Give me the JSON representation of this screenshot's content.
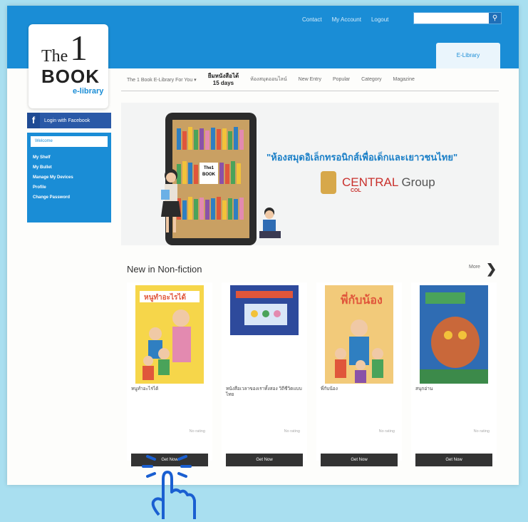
{
  "header": {
    "links": [
      "Contact",
      "My Account",
      "Logout"
    ],
    "search_placeholder": "",
    "search_icon": "search-icon",
    "elibrary_tab": "E-Library"
  },
  "logo": {
    "the": "The",
    "one": "1",
    "book": "BOOK",
    "elibrary": "e-library"
  },
  "nav": {
    "items": [
      "The 1 Book E-Library For You ▾",
      "ห้องสมุดออนไลน์",
      "New Entry",
      "Popular",
      "Category",
      "Magazine"
    ],
    "rent_line1": "ยืมหนังสือได้",
    "rent_line2": "15 days"
  },
  "sidebar": {
    "facebook_label": "Login with Facebook",
    "welcome": "Welcome",
    "username": "",
    "menu": [
      "My Shelf",
      "My Bullet",
      "Manage My Devices",
      "Profile",
      "Change Password"
    ]
  },
  "banner": {
    "headline": "\"ห้องสมุดอิเล็กทรอนิกส์เพื่อเด็กและเยาวชนไทย\"",
    "sponsor_red": "CENTRAL",
    "sponsor_grey": " Group",
    "sub": "COL"
  },
  "section": {
    "title": "New in Non-fiction",
    "more": "More"
  },
  "books": [
    {
      "title": "หนูทำอะไรได้",
      "author": "",
      "meta": "",
      "rating": "No rating",
      "button": "Get Now"
    },
    {
      "title": "หนังสือเวลาของเราทั้งสอง วิถีชีวิตแบบไทย",
      "author": "",
      "meta": "",
      "rating": "No rating",
      "button": "Get Now"
    },
    {
      "title": "พี่กับน้อง",
      "author": "",
      "meta": "",
      "rating": "No rating",
      "button": "Get Now"
    },
    {
      "title": "สนุกอ่าน",
      "author": "",
      "meta": "",
      "rating": "No rating",
      "button": "Get Now"
    }
  ],
  "colors": {
    "primary": "#1a8dd6",
    "background": "#a9dff0",
    "facebook": "#2a59a7",
    "button": "#333333",
    "accent_pink": "#e24a7c"
  }
}
